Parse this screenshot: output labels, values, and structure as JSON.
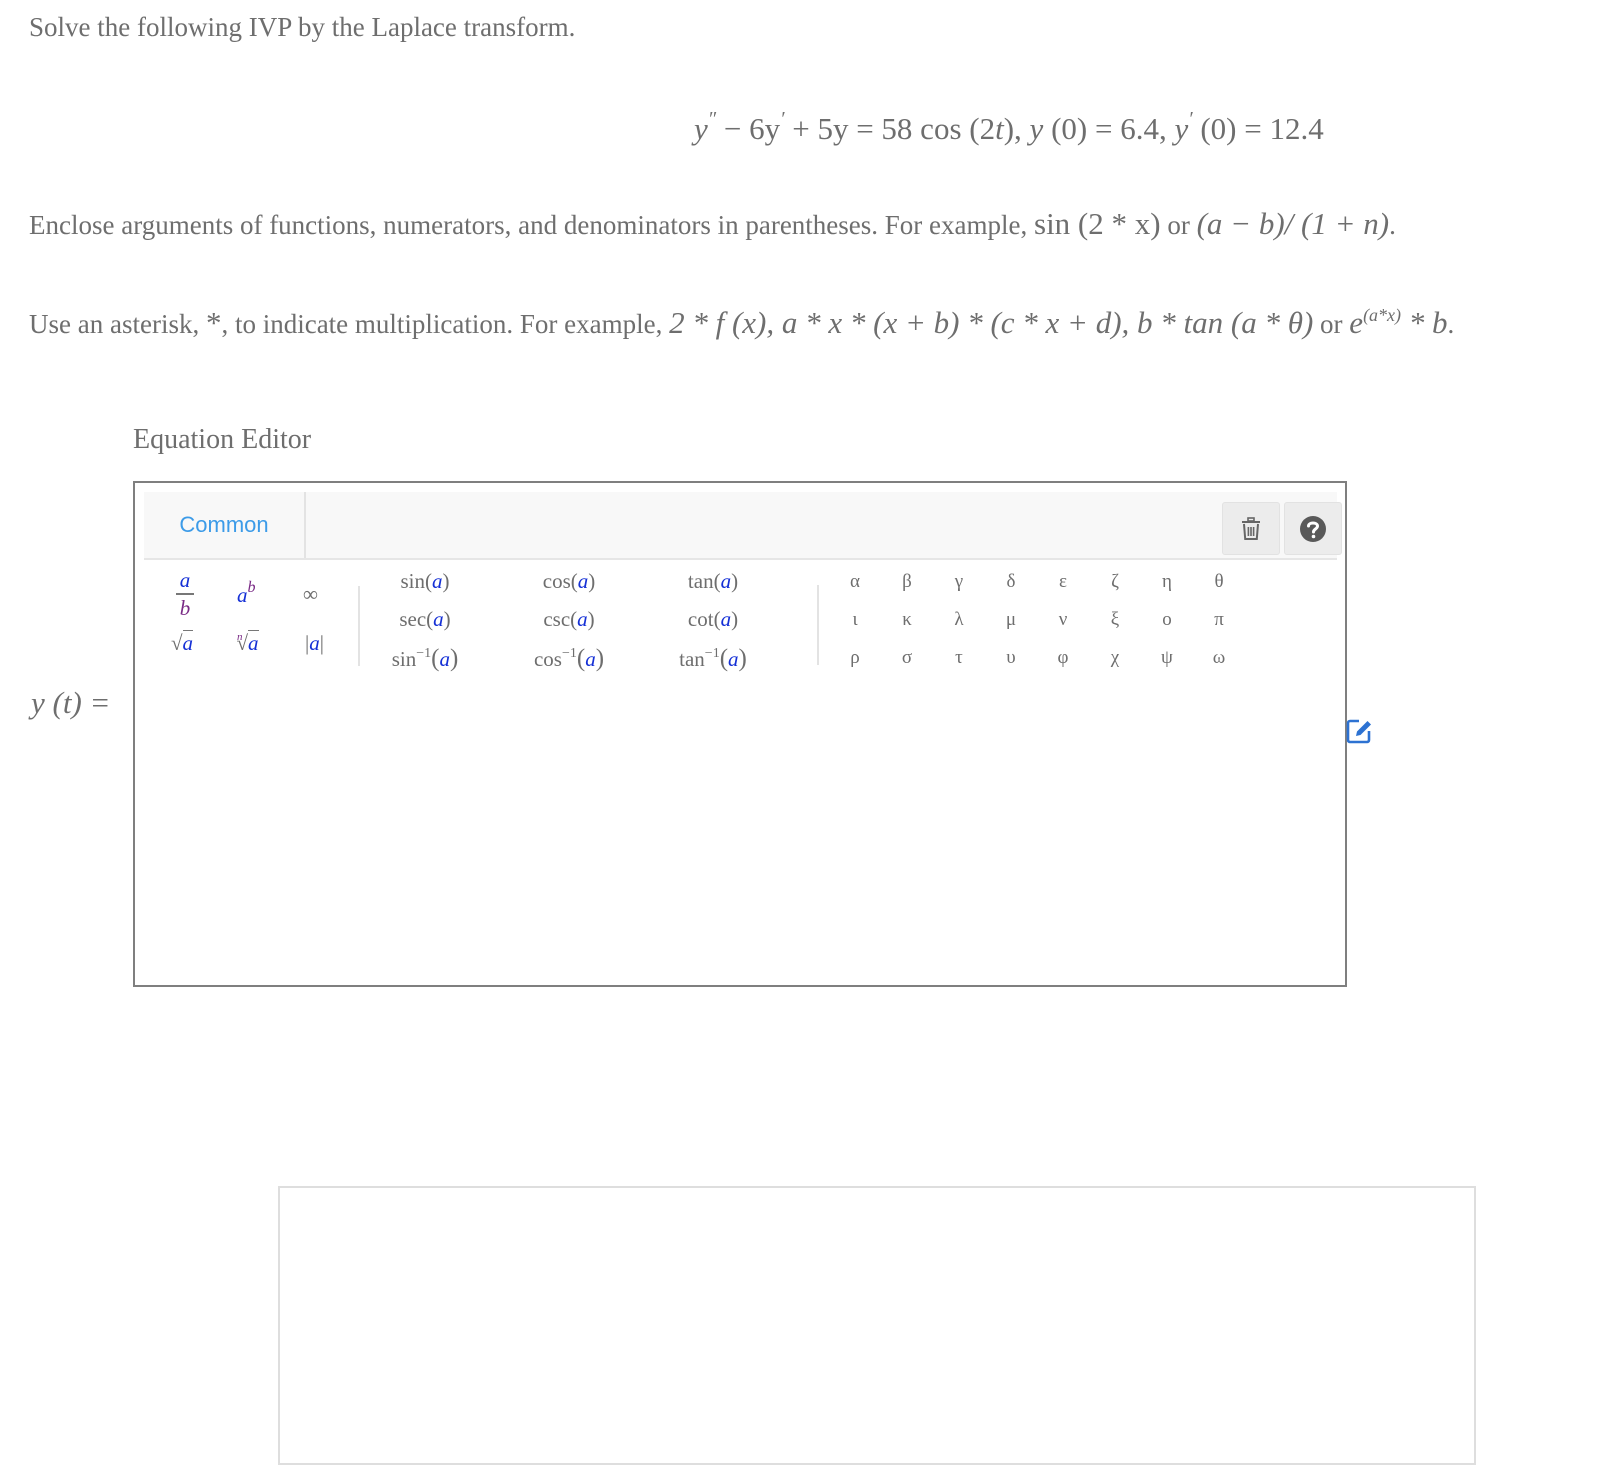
{
  "problem": {
    "title": "Solve the following IVP by the Laplace transform.",
    "equation": {
      "lhs_parts": [
        "y",
        "″",
        " − 6y",
        "′",
        " + 5y = 58 cos (2",
        "t",
        "), ",
        "y",
        " (0) = 6.4, ",
        "y",
        "′",
        " (0) = 12.4"
      ],
      "text": "y'' − 6y' + 5y = 58 cos (2t), y (0) = 6.4, y' (0) = 12.4"
    },
    "instruction_parentheses": {
      "text": "Enclose arguments of functions, numerators, and denominators in parentheses. For example, ",
      "example1": "sin (2 * x)",
      "or": " or ",
      "example2": "(a − b)/ (1 + n)",
      "end": "."
    },
    "instruction_asterisk": {
      "text1": "Use an asterisk, ",
      "star": "*",
      "text2": ", to indicate multiplication. For example, ",
      "example1": "2 * f (x), a * x * (x + b) * (c * x + d), b * tan (a * θ)",
      "or": " or ",
      "example2_base": "e",
      "example2_sup": "(a*x)",
      "example2_tail": " * b",
      "end": "."
    }
  },
  "editor": {
    "label": "Equation Editor",
    "tabs": [
      {
        "label": "Common",
        "active": true
      }
    ],
    "toolbar_buttons": [
      {
        "name": "clear",
        "icon": "trash-icon"
      },
      {
        "name": "help",
        "icon": "question-circle-icon"
      }
    ],
    "palette": {
      "basic": [
        {
          "name": "fraction",
          "top": "a",
          "bottom": "b"
        },
        {
          "name": "power",
          "base": "a",
          "exp": "b"
        },
        {
          "name": "infinity",
          "symbol": "∞"
        },
        {
          "name": "sqrt",
          "radical": "√",
          "arg": "a"
        },
        {
          "name": "nth-root",
          "index": "n",
          "radical": "√",
          "arg": "a"
        },
        {
          "name": "abs",
          "left": "|",
          "arg": "a",
          "right": "|"
        }
      ],
      "functions": [
        {
          "fn": "sin",
          "arg": "a"
        },
        {
          "fn": "cos",
          "arg": "a"
        },
        {
          "fn": "tan",
          "arg": "a"
        },
        {
          "fn": "sec",
          "arg": "a"
        },
        {
          "fn": "csc",
          "arg": "a"
        },
        {
          "fn": "cot",
          "arg": "a"
        },
        {
          "fn": "sin",
          "sup": "−1",
          "arg": "a"
        },
        {
          "fn": "cos",
          "sup": "−1",
          "arg": "a"
        },
        {
          "fn": "tan",
          "sup": "−1",
          "arg": "a"
        }
      ],
      "greek": [
        "α",
        "β",
        "γ",
        "δ",
        "ε",
        "ζ",
        "η",
        "θ",
        "ι",
        "κ",
        "λ",
        "μ",
        "ν",
        "ξ",
        "ο",
        "π",
        "ρ",
        "σ",
        "τ",
        "υ",
        "φ",
        "χ",
        "ψ",
        "ω"
      ]
    },
    "answer_label": "y (t) =",
    "answer_value": "",
    "colors": {
      "tab_active": "#3c9be8",
      "variable": "#1530d6",
      "secondary_variable": "#7a2b86",
      "edit_icon": "#2d72d2"
    }
  }
}
